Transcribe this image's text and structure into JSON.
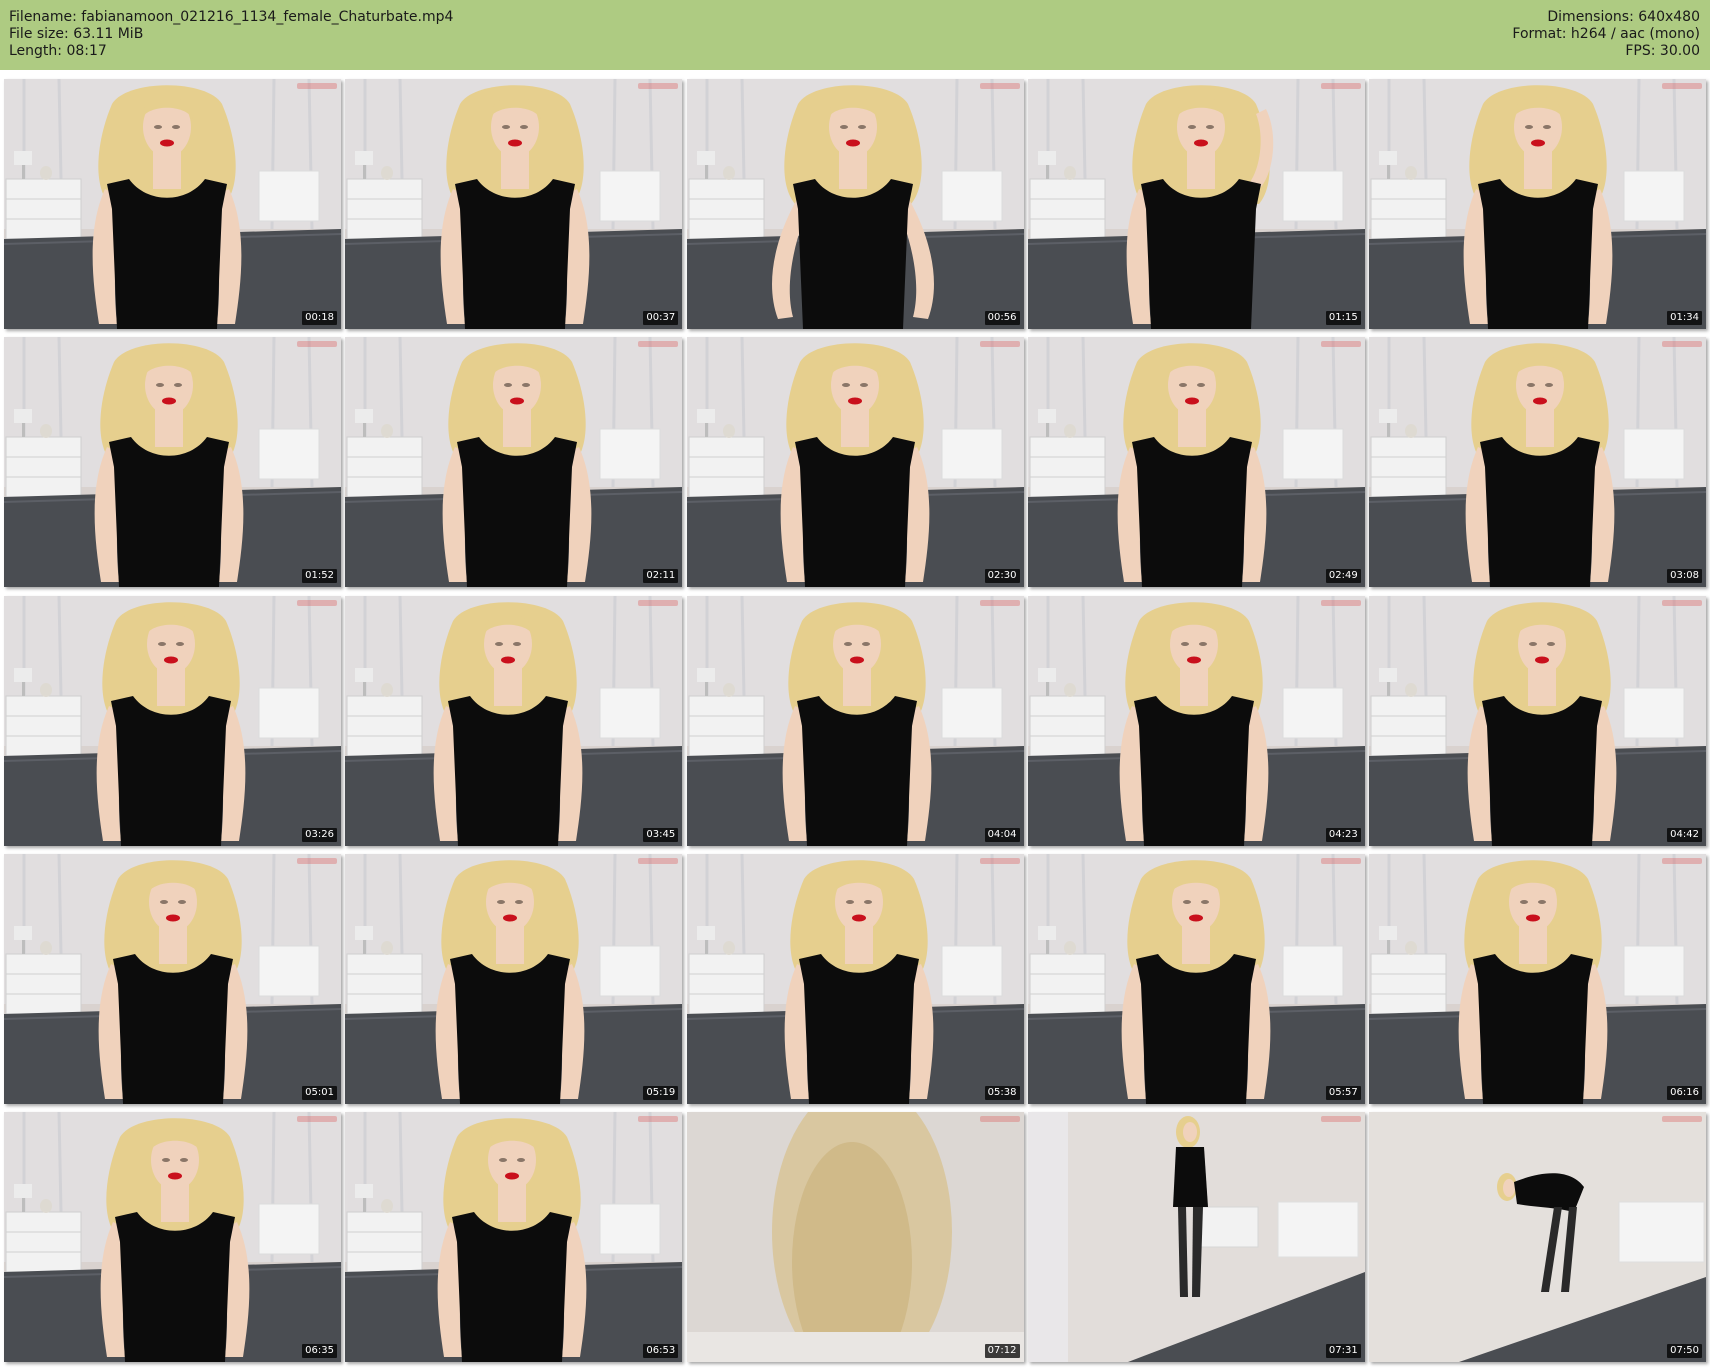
{
  "header": {
    "filename_line": "Filename: fabianamoon_021216_1134_female_Chaturbate.mp4",
    "filesize_line": "File size: 63.11 MiB",
    "length_line": "Length: 08:17",
    "dimensions_line": "Dimensions: 640x480",
    "format_line": "Format: h264 / aac (mono)",
    "fps_line": "FPS: 30.00"
  },
  "colors": {
    "header_bg": "#aecb82",
    "room_wall": "#d9d2cf",
    "curtain": "#e8e8ec",
    "bed": "#4a4d52",
    "dress": "#0c0c0c",
    "hair": "#e6cf8e",
    "skin": "#f0d2bc",
    "lips": "#c9101c"
  },
  "thumbnails": [
    {
      "time": "00:18",
      "scene": "seated"
    },
    {
      "time": "00:37",
      "scene": "seated"
    },
    {
      "time": "00:56",
      "scene": "seated-wide"
    },
    {
      "time": "01:15",
      "scene": "seated-hairtouch"
    },
    {
      "time": "01:34",
      "scene": "seated"
    },
    {
      "time": "01:52",
      "scene": "seated"
    },
    {
      "time": "02:11",
      "scene": "seated"
    },
    {
      "time": "02:30",
      "scene": "seated"
    },
    {
      "time": "02:49",
      "scene": "seated"
    },
    {
      "time": "03:08",
      "scene": "seated"
    },
    {
      "time": "03:26",
      "scene": "seated"
    },
    {
      "time": "03:45",
      "scene": "seated"
    },
    {
      "time": "04:04",
      "scene": "seated"
    },
    {
      "time": "04:23",
      "scene": "seated"
    },
    {
      "time": "04:42",
      "scene": "seated"
    },
    {
      "time": "05:01",
      "scene": "seated"
    },
    {
      "time": "05:19",
      "scene": "seated"
    },
    {
      "time": "05:38",
      "scene": "seated"
    },
    {
      "time": "05:57",
      "scene": "seated"
    },
    {
      "time": "06:16",
      "scene": "seated"
    },
    {
      "time": "06:35",
      "scene": "seated"
    },
    {
      "time": "06:53",
      "scene": "seated"
    },
    {
      "time": "07:12",
      "scene": "blur"
    },
    {
      "time": "07:31",
      "scene": "standing"
    },
    {
      "time": "07:50",
      "scene": "bending"
    }
  ]
}
